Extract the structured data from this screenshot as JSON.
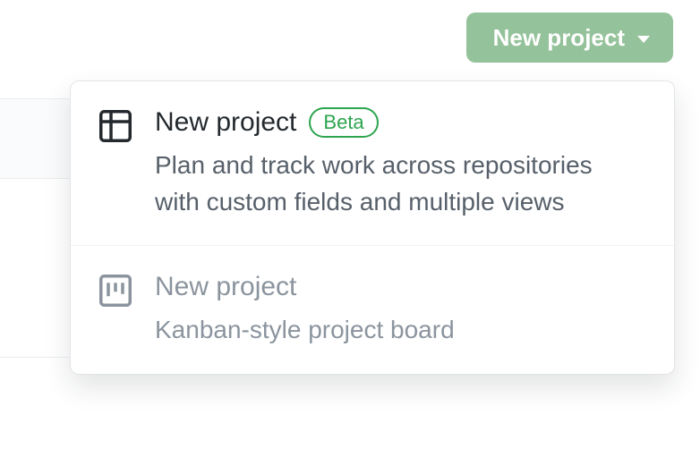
{
  "button": {
    "label": "New project"
  },
  "menu": {
    "items": [
      {
        "title": "New project",
        "badge": "Beta",
        "description": "Plan and track work across repositories with custom fields and multiple views"
      },
      {
        "title": "New project",
        "description": "Kanban-style project board"
      }
    ]
  }
}
